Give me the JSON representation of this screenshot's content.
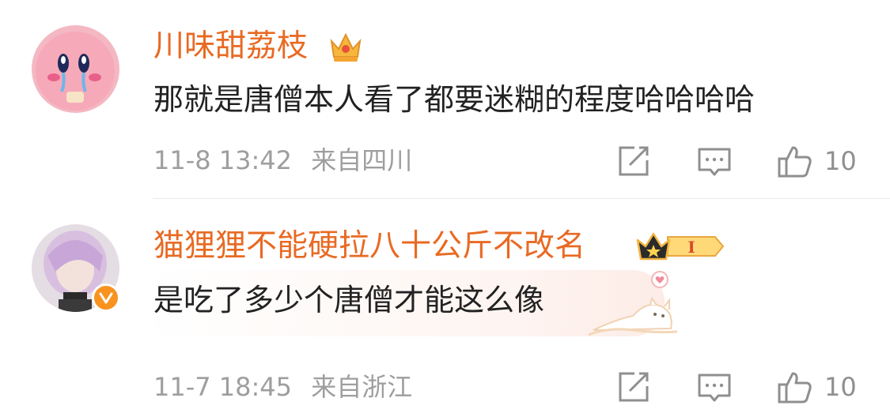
{
  "comments": [
    {
      "username": "川味甜荔枝",
      "avatar": "kirby-avatar",
      "badge": "crown-badge",
      "text": "那就是唐僧本人看了都要迷糊的程度哈哈哈哈",
      "time": "11-8 13:42",
      "location": "来自四川",
      "likes": "10"
    },
    {
      "username": "猫狸狸不能硬拉八十公斤不改名",
      "avatar": "anime-cosplay-avatar",
      "badge": "crown-level-badge",
      "badge_level": "I",
      "verified": true,
      "text": "是吃了多少个唐僧才能这么像",
      "time": "11-7 18:45",
      "location": "来自浙江",
      "likes": "10"
    }
  ],
  "colors": {
    "username": "#e86a23",
    "text": "#222222",
    "meta": "#9e9e9e",
    "icon": "#8f8f8f",
    "verified": "#f7931e"
  }
}
